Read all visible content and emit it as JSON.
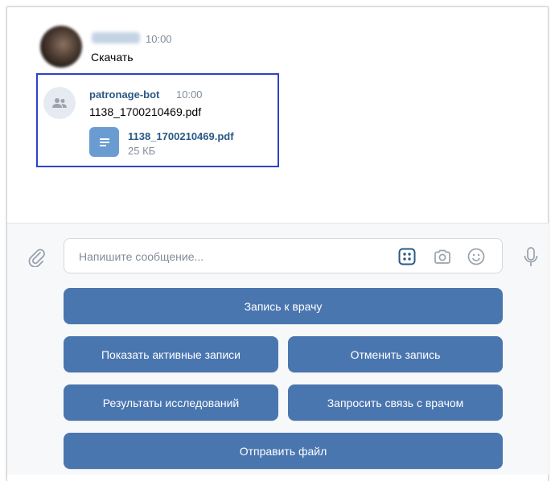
{
  "previous_message": {
    "time": "10:00",
    "text": "Скачать"
  },
  "bot_message": {
    "sender": "patronage-bot",
    "time": "10:00",
    "text": "1138_1700210469.pdf",
    "attachment": {
      "file_name": "1138_1700210469.pdf",
      "file_size": "25 КБ",
      "icon": "document-icon"
    }
  },
  "composer": {
    "placeholder": "Напишите сообщение...",
    "icons": [
      "attach-icon",
      "bot-keyboard-icon",
      "camera-icon",
      "emoji-icon",
      "microphone-icon"
    ]
  },
  "keyboard": {
    "buttons": [
      "Запись к врачу",
      "Показать активные записи",
      "Отменить запись",
      "Результаты исследований",
      "Запросить связь с врачом",
      "Отправить файл"
    ]
  },
  "colors": {
    "button_bg": "#4a76b0",
    "link": "#2a5885",
    "secondary_text": "#818c99",
    "highlight_border": "#2d43c8"
  }
}
